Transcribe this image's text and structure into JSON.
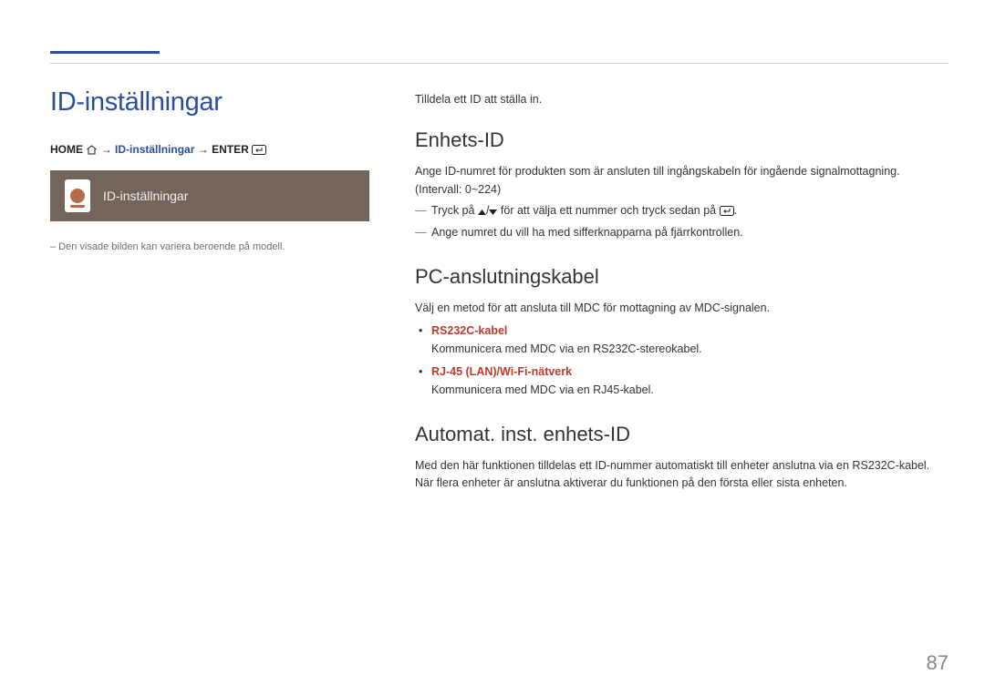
{
  "page_number": "87",
  "left": {
    "title": "ID-inställningar",
    "breadcrumb": {
      "home": "HOME",
      "sep": "→",
      "mid": "ID-inställningar",
      "enter": "ENTER"
    },
    "card_title": "ID-inställningar",
    "note": "– Den visade bilden kan variera beroende på modell."
  },
  "right": {
    "intro": "Tilldela ett ID att ställa in.",
    "s1": {
      "heading": "Enhets-ID",
      "p1": "Ange ID-numret för produkten som är ansluten till ingångskabeln för ingående signalmottagning. (Intervall: 0~224)",
      "d1a": "Tryck på ",
      "d1_sep": "/",
      "d1b": " för att välja ett nummer och tryck sedan på ",
      "d1_end": ".",
      "d2": "Ange numret du vill ha med sifferknapparna på fjärrkontrollen."
    },
    "s2": {
      "heading": "PC-anslutningskabel",
      "p1": "Välj en metod för att ansluta till MDC för mottagning av MDC-signalen.",
      "opt1": "RS232C-kabel",
      "opt1_desc": "Kommunicera med MDC via en RS232C-stereokabel.",
      "opt2": "RJ-45 (LAN)/Wi-Fi-nätverk",
      "opt2_desc": "Kommunicera med MDC via en RJ45-kabel."
    },
    "s3": {
      "heading": "Automat. inst. enhets-ID",
      "p1": "Med den här funktionen tilldelas ett ID-nummer automatiskt till enheter anslutna via en RS232C-kabel.",
      "p2": "När flera enheter är anslutna aktiverar du funktionen på den första eller sista enheten."
    }
  }
}
